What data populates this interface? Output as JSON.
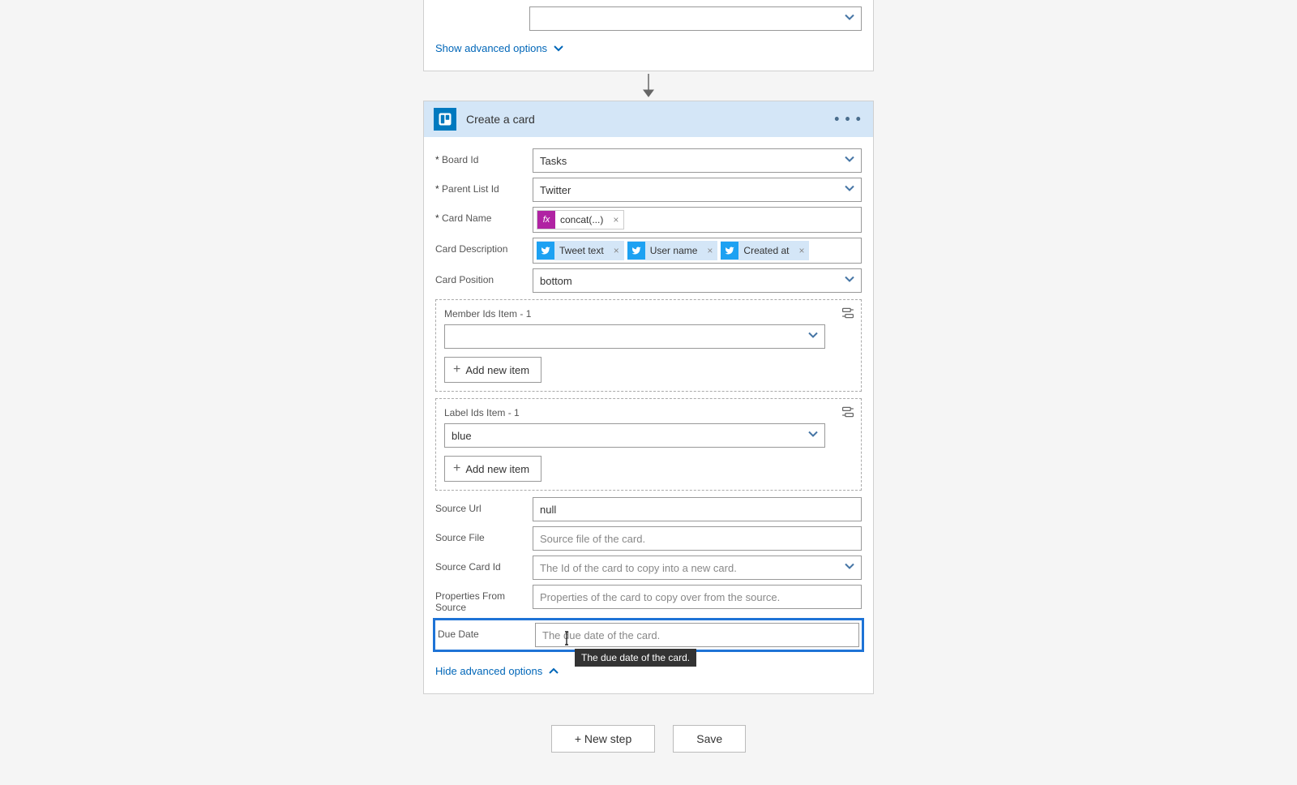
{
  "top_card": {
    "show_advanced": "Show advanced options"
  },
  "action": {
    "title": "Create a card",
    "fields": {
      "board_id": {
        "label": "Board Id",
        "value": "Tasks"
      },
      "parent_list_id": {
        "label": "Parent List Id",
        "value": "Twitter"
      },
      "card_name": {
        "label": "Card Name",
        "fx_token": "concat(...)"
      },
      "card_description": {
        "label": "Card Description",
        "tokens": [
          "Tweet text",
          "User name",
          "Created at"
        ]
      },
      "card_position": {
        "label": "Card Position",
        "value": "bottom"
      },
      "member_ids": {
        "label": "Member Ids Item - 1",
        "add_btn": "Add new item"
      },
      "label_ids": {
        "label": "Label Ids Item - 1",
        "value": "blue",
        "add_btn": "Add new item"
      },
      "source_url": {
        "label": "Source Url",
        "value": "null"
      },
      "source_file": {
        "label": "Source File",
        "placeholder": "Source file of the card."
      },
      "source_card_id": {
        "label": "Source Card Id",
        "placeholder": "The Id of the card to copy into a new card."
      },
      "props_from_source": {
        "label": "Properties From Source",
        "placeholder": "Properties of the card to copy over from the source."
      },
      "due_date": {
        "label": "Due Date",
        "placeholder": "The due date of the card.",
        "tooltip": "The due date of the card."
      }
    },
    "hide_advanced": "Hide advanced options"
  },
  "footer": {
    "new_step": "+ New step",
    "save": "Save"
  }
}
